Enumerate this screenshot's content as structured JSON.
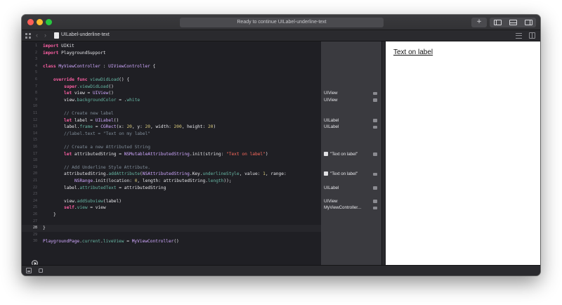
{
  "window": {
    "status": "Ready to continue UILabel-underline-text",
    "add_button": "+"
  },
  "tab": {
    "file_name": "UILabel-underline-text",
    "back_arrow": "‹",
    "forward_arrow": "›"
  },
  "icons": {
    "grid": "grid-icon",
    "file": "swift-file-icon",
    "run": "play-icon",
    "list": "list-icon",
    "split": "split-editor-icon"
  },
  "editor": {
    "current_line": 28,
    "lines": [
      {
        "n": "1"
      },
      {
        "n": "2"
      },
      {
        "n": "3"
      },
      {
        "n": "4"
      },
      {
        "n": "5"
      },
      {
        "n": "6"
      },
      {
        "n": "7"
      },
      {
        "n": "8"
      },
      {
        "n": "9"
      },
      {
        "n": "10"
      },
      {
        "n": "11"
      },
      {
        "n": "12"
      },
      {
        "n": "13"
      },
      {
        "n": "14"
      },
      {
        "n": "15"
      },
      {
        "n": "16"
      },
      {
        "n": "17"
      },
      {
        "n": "18"
      },
      {
        "n": "19"
      },
      {
        "n": "20"
      },
      {
        "n": "21"
      },
      {
        "n": "22"
      },
      {
        "n": "23"
      },
      {
        "n": "24"
      },
      {
        "n": "25"
      },
      {
        "n": "26"
      },
      {
        "n": "27"
      },
      {
        "n": "28"
      },
      {
        "n": "29"
      },
      {
        "n": "30"
      }
    ],
    "tokens": {
      "l1_kw": "import",
      "l1_rest": " UIKit",
      "l2_kw": "import",
      "l2_rest": " PlaygroundSupport",
      "l4_kw": "class",
      "l4_name": " MyViewController",
      "l4_colon": " : ",
      "l4_type": "UIViewController",
      "l4_brace": " {",
      "l6_kw1": "override",
      "l6_kw2": " func",
      "l6_fn": " viewDidLoad",
      "l6_rest": "() {",
      "l7_kw": "super",
      "l7_fn": ".viewDidLoad",
      "l7_rest": "()",
      "l8_kw": "let",
      "l8_mid": " view = ",
      "l8_type": "UIView",
      "l8_rest": "()",
      "l9_a": "view.",
      "l9_fn": "backgroundColor",
      "l9_b": " = .",
      "l9_c": "white",
      "l11_cm": "// Create new label",
      "l12_kw": "let",
      "l12_mid": " label = ",
      "l12_type": "UILabel",
      "l12_rest": "()",
      "l13_a": "label.",
      "l13_fn": "frame",
      "l13_b": " = ",
      "l13_type": "CGRect",
      "l13_c": "(x: ",
      "l13_n1": "20",
      "l13_d": ", y: ",
      "l13_n2": "20",
      "l13_e": ", width: ",
      "l13_n3": "200",
      "l13_f": ", height: ",
      "l13_n4": "20",
      "l13_g": ")",
      "l14_cm": "//label.text = \"Text on my label\"",
      "l16_cm": "// Create a new Attributed String",
      "l17_kw": "let",
      "l17_mid": " attributedString = ",
      "l17_type": "NSMutableAttributedString",
      "l17_b": ".init(string: ",
      "l17_st": "\"Text on label\"",
      "l17_c": ")",
      "l19_cm": "// Add Underline Style Attribute.",
      "l20_a": "attributedString.",
      "l20_fn": "addAttribute",
      "l20_b": "(",
      "l20_type": "NSAttributedString",
      "l20_c": ".Key.",
      "l20_fn2": "underlineStyle",
      "l20_d": ", value: ",
      "l20_n": "1",
      "l20_e": ", range:",
      "l21_type": "NSRange",
      "l21_a": ".init(location: ",
      "l21_n": "0",
      "l21_b": ", length: attributedString.",
      "l21_fn": "length",
      "l21_c": "));",
      "l22_a": "label.",
      "l22_fn": "attributedText",
      "l22_b": " = attributedString",
      "l24_a": "view.",
      "l24_fn": "addSubview",
      "l24_b": "(label)",
      "l25_kw": "self",
      "l25_a": ".",
      "l25_fn": "view",
      "l25_b": " = view",
      "l26_text": "}",
      "l28_text": "}",
      "l30_type": "PlaygroundPage",
      "l30_a": ".",
      "l30_fn": "current",
      "l30_b": ".",
      "l30_fn2": "liveView",
      "l30_c": " = ",
      "l30_type2": "MyViewController",
      "l30_d": "()"
    }
  },
  "results": [
    {
      "line": 8,
      "text": "UIView"
    },
    {
      "line": 9,
      "text": "UIView"
    },
    {
      "line": 12,
      "text": "UILabel"
    },
    {
      "line": 13,
      "text": "UILabel"
    },
    {
      "line": 17,
      "text": "\"Text on label\"",
      "checkbox": true
    },
    {
      "line": 20,
      "text": "\"Text on label\"",
      "checkbox": true
    },
    {
      "line": 22,
      "text": "UILabel"
    },
    {
      "line": 24,
      "text": "UIView"
    },
    {
      "line": 25,
      "text": "MyViewController..."
    }
  ],
  "live_view": {
    "label_text": "Text on label"
  },
  "colors": {
    "editor_bg": "#1f1f24",
    "keyword": "#fc5fa3",
    "type": "#d0a8ff",
    "function": "#67b7a4",
    "comment": "#7f8c98",
    "string": "#fc6a5d",
    "number": "#d9c97c",
    "results_bg": "#3a3a3f"
  }
}
